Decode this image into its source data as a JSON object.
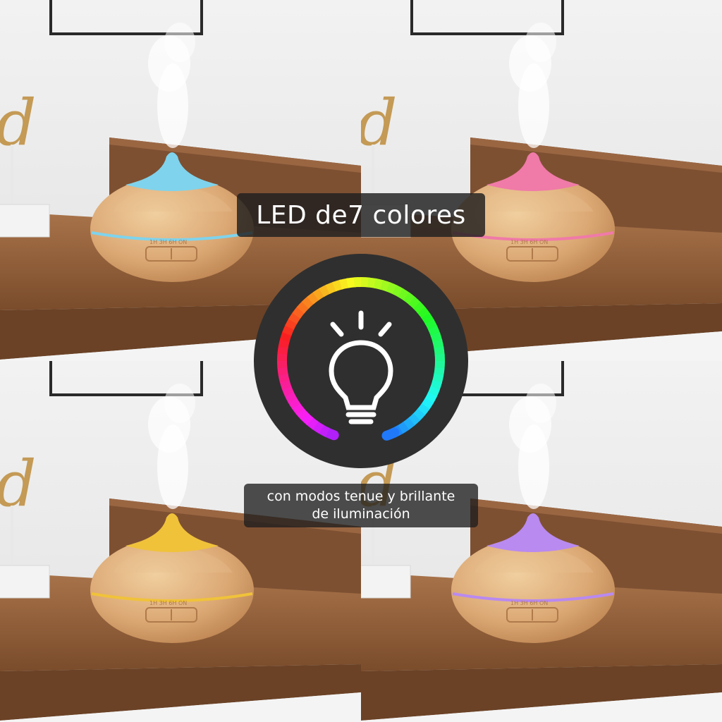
{
  "title": "LED de7 colores",
  "subtitle_line1": "con modos tenue y brillante",
  "subtitle_line2": "de iluminación",
  "control_label": "1H 3H 6H ON",
  "light_colors": {
    "top_left": "#7fd3ec",
    "top_right": "#f07aa8",
    "bottom_left": "#f0c23a",
    "bottom_right": "#b98af0"
  },
  "icon": "light-bulb-icon"
}
